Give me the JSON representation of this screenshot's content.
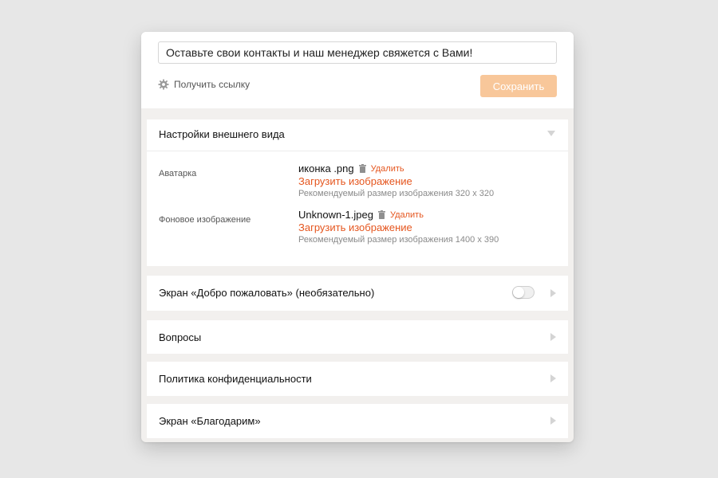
{
  "header": {
    "title_value": "Оставьте свои контакты и наш менеджер свяжется с Вами!",
    "get_link_label": "Получить ссылку",
    "save_label": "Сохранить"
  },
  "appearance": {
    "title": "Настройки внешнего вида",
    "expanded": true,
    "avatar": {
      "label": "Аватарка",
      "file_name": "иконка .png",
      "delete_label": "Удалить",
      "upload_label": "Загрузить изображение",
      "hint": "Рекомендуемый размер изображения 320 x 320"
    },
    "background": {
      "label": "Фоновое изображение",
      "file_name": "Unknown-1.jpeg",
      "delete_label": "Удалить",
      "upload_label": "Загрузить изображение",
      "hint": "Рекомендуемый размер изображения 1400 x 390"
    }
  },
  "sections": {
    "welcome": {
      "title": "Экран «Добро пожаловать» (необязательно)",
      "toggle_on": false
    },
    "questions": {
      "title": "Вопросы"
    },
    "privacy": {
      "title": "Политика конфиденциальности"
    },
    "thanks": {
      "title": "Экран «Благодарим»"
    }
  },
  "colors": {
    "accent": "#e5561f",
    "save_button": "#f8c79a",
    "panel_background": "#f2f0ee"
  },
  "icons": {
    "get_link": "gear-icon",
    "delete": "trash-icon",
    "collapsed": "chevron-right-icon",
    "expanded": "chevron-down-icon"
  }
}
